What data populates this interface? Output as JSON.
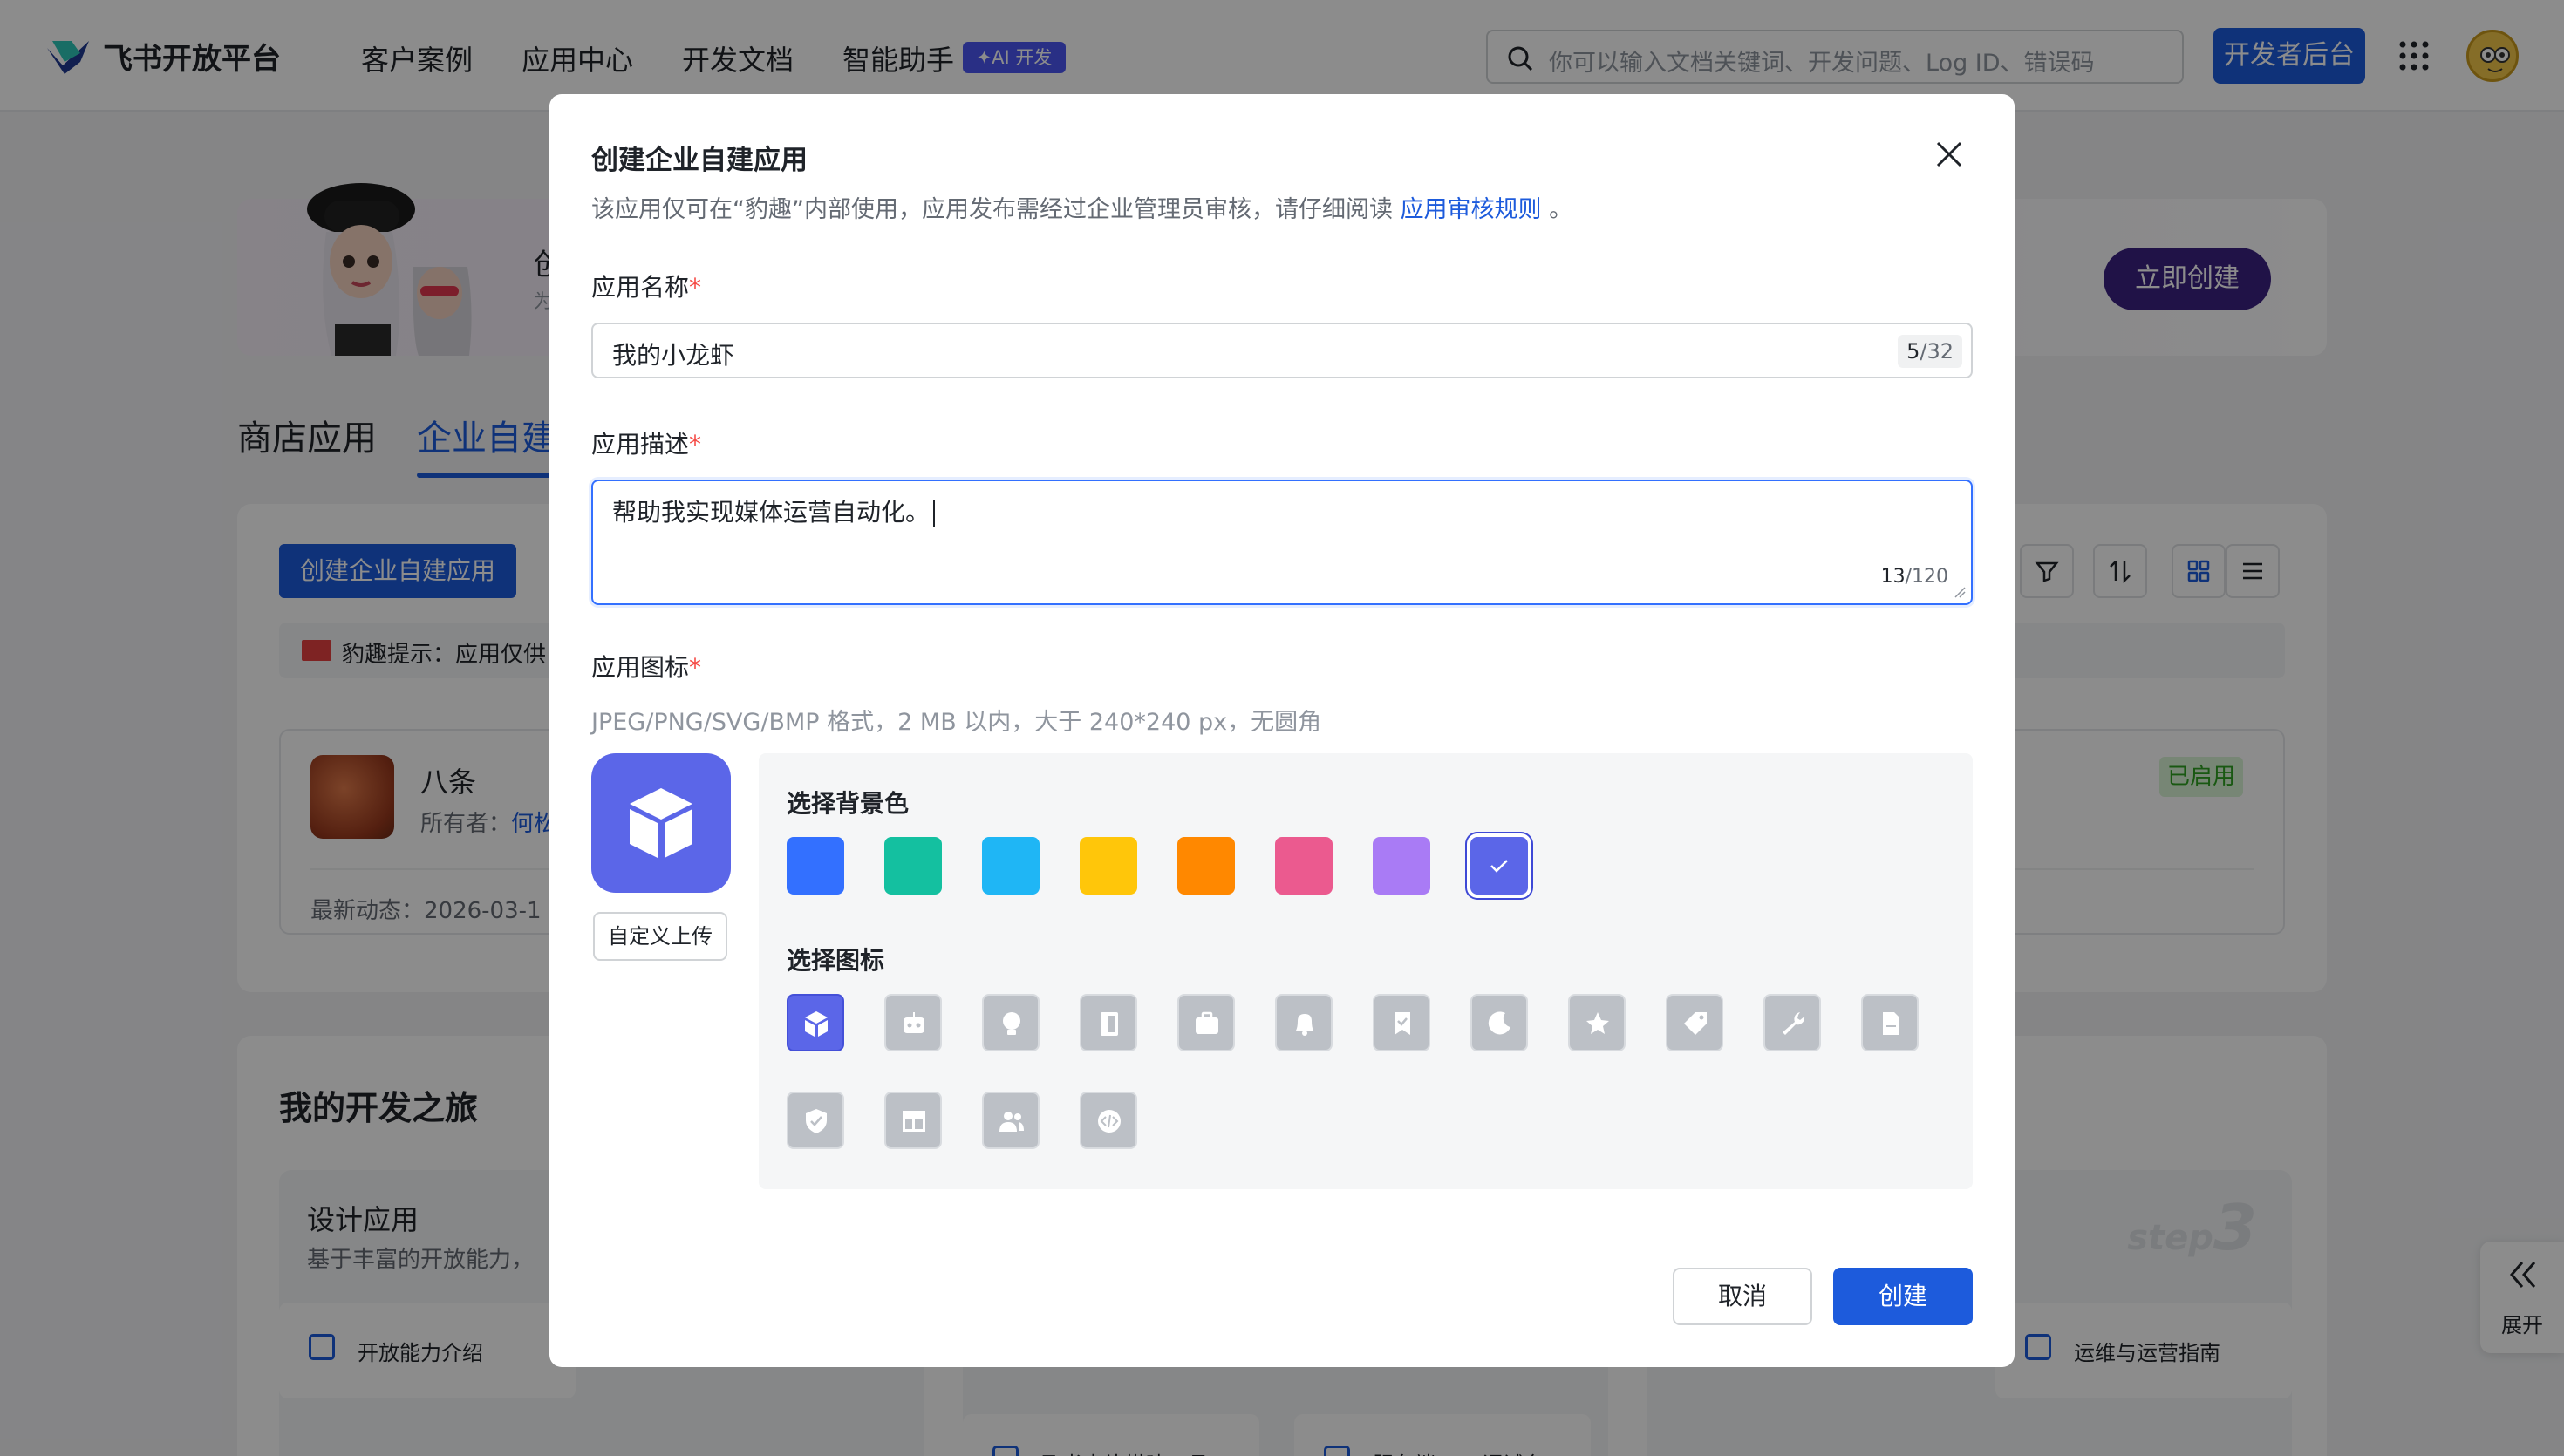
{
  "brand": {
    "name": "飞书开放平台"
  },
  "nav": {
    "items": [
      "客户案例",
      "应用中心",
      "开发文档",
      "智能助手"
    ],
    "ai_badge": "✦AI 开发",
    "search_placeholder": "你可以输入文档关键词、开发问题、Log ID、错误码",
    "dev_console": "开发者后台"
  },
  "background": {
    "banner_cut_title": "创",
    "banner_cut_sub": "为",
    "create_now": "立即创建",
    "tabs": {
      "store": "商店应用",
      "enterprise": "企业自建"
    },
    "create_enterprise_btn": "创建企业自建应用",
    "tip": "豹趣提示：应用仅供",
    "app": {
      "name": "八条",
      "owner_label": "所有者：",
      "owner_name": "何松",
      "status": "已启用",
      "recent": "最新动态：2026-03-1"
    },
    "journey": {
      "title": "我的开发之旅",
      "design_title": "设计应用",
      "design_sub": "基于丰富的开放能力，",
      "card_capabilities": "开放能力介绍",
      "card_ops": "运维与运营指南",
      "card_card_builder": "飞书卡片搭建工具",
      "card_api_debug": "服务端 API 调试台",
      "step": "step",
      "step_num": "3"
    },
    "expand": "展开"
  },
  "modal": {
    "title": "创建企业自建应用",
    "desc_before": "该应用仅可在“豹趣”内部使用，应用发布需经过企业管理员审核，请仔细阅读 ",
    "desc_link": "应用审核规则",
    "desc_after": " 。",
    "name_label": "应用名称",
    "name_value": "我的小龙虾",
    "name_count": "5",
    "name_max": "/32",
    "desc_label": "应用描述",
    "desc_value": "帮助我实现媒体运营自动化。",
    "desc_count": "13",
    "desc_max": "/120",
    "icon_label": "应用图标",
    "required_mark": "*",
    "icon_hint": "JPEG/PNG/SVG/BMP 格式，2 MB 以内，大于 240*240 px，无圆角",
    "upload_btn": "自定义上传",
    "bg_title": "选择背景色",
    "icon_title": "选择图标",
    "bg_colors": [
      "#3370ff",
      "#14c0a0",
      "#1fb6f5",
      "#ffc60a",
      "#ff8800",
      "#eb5a8f",
      "#a97bf5",
      "#5b66e8"
    ],
    "selected_bg_index": 7,
    "icons": [
      "cube-icon",
      "robot-icon",
      "lightbulb-icon",
      "door-icon",
      "briefcase-icon",
      "bell-icon",
      "bookmark-icon",
      "moon-icon",
      "star-icon",
      "tag-icon",
      "wrench-icon",
      "document-icon",
      "shield-icon",
      "layout-icon",
      "users-icon",
      "code-icon"
    ],
    "selected_icon_index": 0,
    "cancel": "取消",
    "create": "创建"
  }
}
